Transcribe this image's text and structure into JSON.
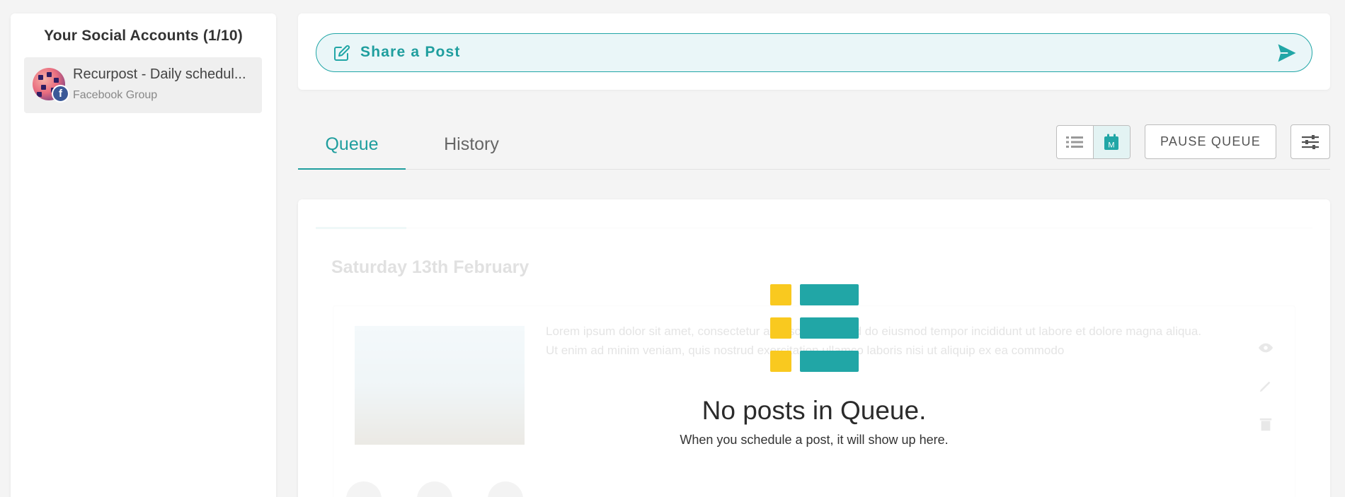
{
  "sidebar": {
    "title": "Your Social Accounts (1/10)",
    "accounts": [
      {
        "name": "Recurpost - Daily schedul...",
        "type": "Facebook Group",
        "network_icon": "f"
      }
    ]
  },
  "share": {
    "label": "Share a Post"
  },
  "tabs": [
    {
      "label": "Queue"
    },
    {
      "label": "History"
    }
  ],
  "toolbar": {
    "pause_label": "PAUSE QUEUE",
    "calendar_icon_letter": "M"
  },
  "ghost_preview": {
    "date": "Saturday 13th February",
    "post_text": "Lorem ipsum dolor sit amet, consectetur adipiscing elit, sed do eiusmod tempor incididunt ut labore et dolore magna aliqua. Ut enim ad minim veniam, quis nostrud exercitation ullamco laboris nisi ut aliquip ex ea commodo"
  },
  "empty_state": {
    "title": "No posts in Queue.",
    "subtitle": "When you schedule a post, it will show up here."
  },
  "colors": {
    "accent": "#21a6a6",
    "yellow": "#f9c91f",
    "facebook": "#3b5998"
  }
}
